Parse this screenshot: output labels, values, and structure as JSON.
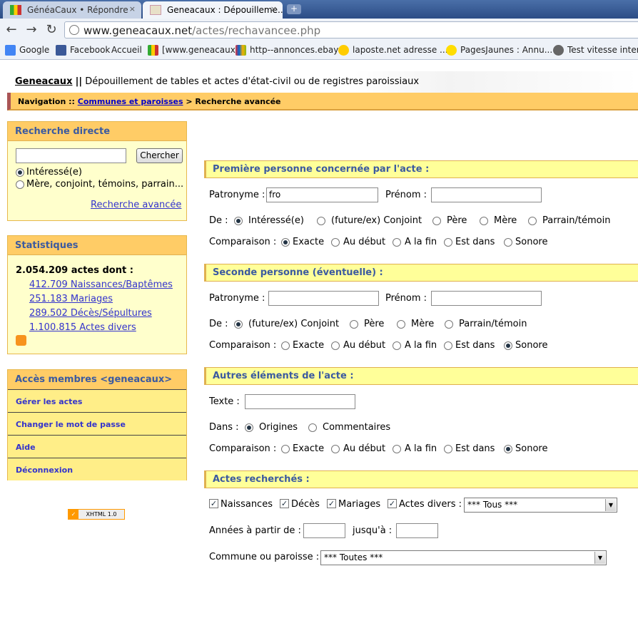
{
  "browser": {
    "tabs": [
      {
        "title": "GénéaCaux • Répondre"
      },
      {
        "title": "Geneacaux : Dépouilleme..."
      }
    ],
    "tab_close": "×",
    "new_tab": "+",
    "url_host": "www.geneacaux.net",
    "url_path": "/actes/rechavancee.php",
    "bookmarks": [
      "Google",
      "Facebook",
      "Accueil",
      "[www.geneacaux",
      "http--annonces.ebay",
      "laposte.net  adresse ...",
      "PagesJaunes : Annu...",
      "Test vitesse interne"
    ]
  },
  "header": {
    "site": "Geneacaux",
    "sep": "||",
    "desc": "Dépouillement de tables et actes d'état-civil ou de registres paroissiaux"
  },
  "nav": {
    "prefix": "Navigation ::",
    "link": "Communes et paroisses",
    "current": "> Recherche avancée"
  },
  "direct": {
    "title": "Recherche directe",
    "search_value": "",
    "button": "Chercher",
    "opt1": "Intéressé(e)",
    "opt2": "Mère, conjoint, témoins, parrain...",
    "advanced": "Recherche avancée"
  },
  "stats": {
    "title": "Statistiques",
    "total": "2.054.209 actes dont :",
    "items": [
      "412.709 Naissances/Baptêmes",
      "251.183 Mariages",
      "289.502 Décès/Sépultures",
      "1.100.815 Actes divers"
    ]
  },
  "members": {
    "title": "Accès membres <geneacaux>",
    "items": [
      "Gérer les actes",
      "Changer le mot de passe",
      "Aide",
      "Déconnexion"
    ]
  },
  "badge": "XHTML 1.0",
  "p1": {
    "title": "Première personne concernée par l'acte :",
    "patronyme_label": "Patronyme :",
    "patronyme": "fro",
    "prenom_label": "Prénom :",
    "prenom": "",
    "de_label": "De :",
    "de_opts": [
      "Intéressé(e)",
      "(future/ex) Conjoint",
      "Père",
      "Mère",
      "Parrain/témoin"
    ],
    "comp_label": "Comparaison :",
    "comp_opts": [
      "Exacte",
      "Au début",
      "A la fin",
      "Est dans",
      "Sonore"
    ]
  },
  "p2": {
    "title": "Seconde personne (éventuelle) :",
    "patronyme_label": "Patronyme :",
    "patronyme": "",
    "prenom_label": "Prénom :",
    "prenom": "",
    "de_label": "De :",
    "de_opts": [
      "(future/ex) Conjoint",
      "Père",
      "Mère",
      "Parrain/témoin"
    ],
    "comp_label": "Comparaison :",
    "comp_opts": [
      "Exacte",
      "Au début",
      "A la fin",
      "Est dans",
      "Sonore"
    ]
  },
  "autres": {
    "title": "Autres éléments de l'acte :",
    "texte_label": "Texte :",
    "texte": "",
    "dans_label": "Dans :",
    "dans_opts": [
      "Origines",
      "Commentaires"
    ],
    "comp_label": "Comparaison :",
    "comp_opts": [
      "Exacte",
      "Au début",
      "A la fin",
      "Est dans",
      "Sonore"
    ]
  },
  "actes": {
    "title": "Actes recherchés :",
    "types": [
      "Naissances",
      "Décès",
      "Mariages",
      "Actes divers :"
    ],
    "type_select": "*** Tous ***",
    "annees_label": "Années à partir de :",
    "annee_from": "",
    "jusqua_label": "jusqu'à :",
    "annee_to": "",
    "commune_label": "Commune ou paroisse :",
    "commune_select": "*** Toutes ***"
  }
}
